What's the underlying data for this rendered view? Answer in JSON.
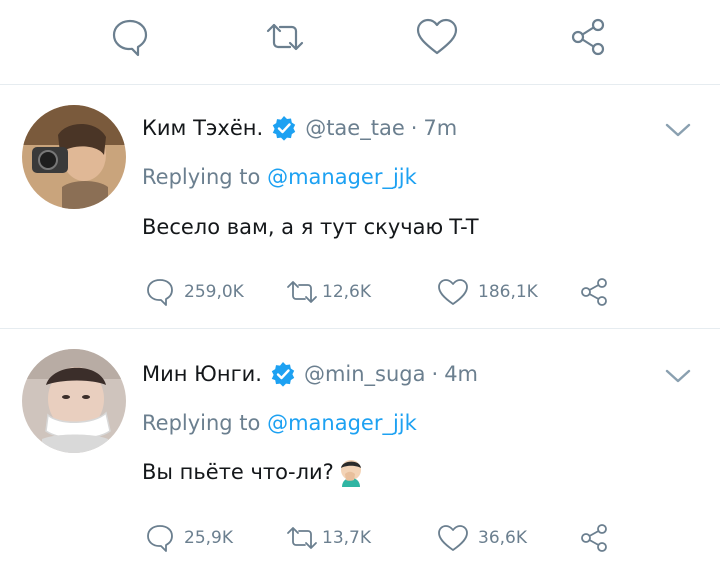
{
  "top_actions": {
    "reply_icon": "reply-bubble-icon",
    "retweet_icon": "retweet-icon",
    "like_icon": "heart-icon",
    "share_icon": "share-icon"
  },
  "tweets": [
    {
      "display_name": "Ким Тэхён.",
      "handle": "@tae_tae",
      "dot": "·",
      "time": "7m",
      "replying_to_prefix": "Replying to ",
      "replying_to_handle": "@manager_jjk",
      "text": "Весело вам, а я тут скучаю",
      "text_suffix": "T-T",
      "reply_count": "259,0K",
      "retweet_count": "12,6K",
      "like_count": "186,1K"
    },
    {
      "display_name": "Мин Юнги.",
      "handle": "@min_suga",
      "dot": "·",
      "time": "4m",
      "replying_to_prefix": "Replying to ",
      "replying_to_handle": "@manager_jjk",
      "text": "Вы пьёте что-ли?",
      "emoji": "facepalm-emoji",
      "reply_count": "25,9K",
      "retweet_count": "13,7K",
      "like_count": "36,6K"
    }
  ],
  "colors": {
    "accent": "#1da1f2",
    "muted": "#6b7f8f",
    "text": "#14171a",
    "divider": "#e6ecf0"
  }
}
